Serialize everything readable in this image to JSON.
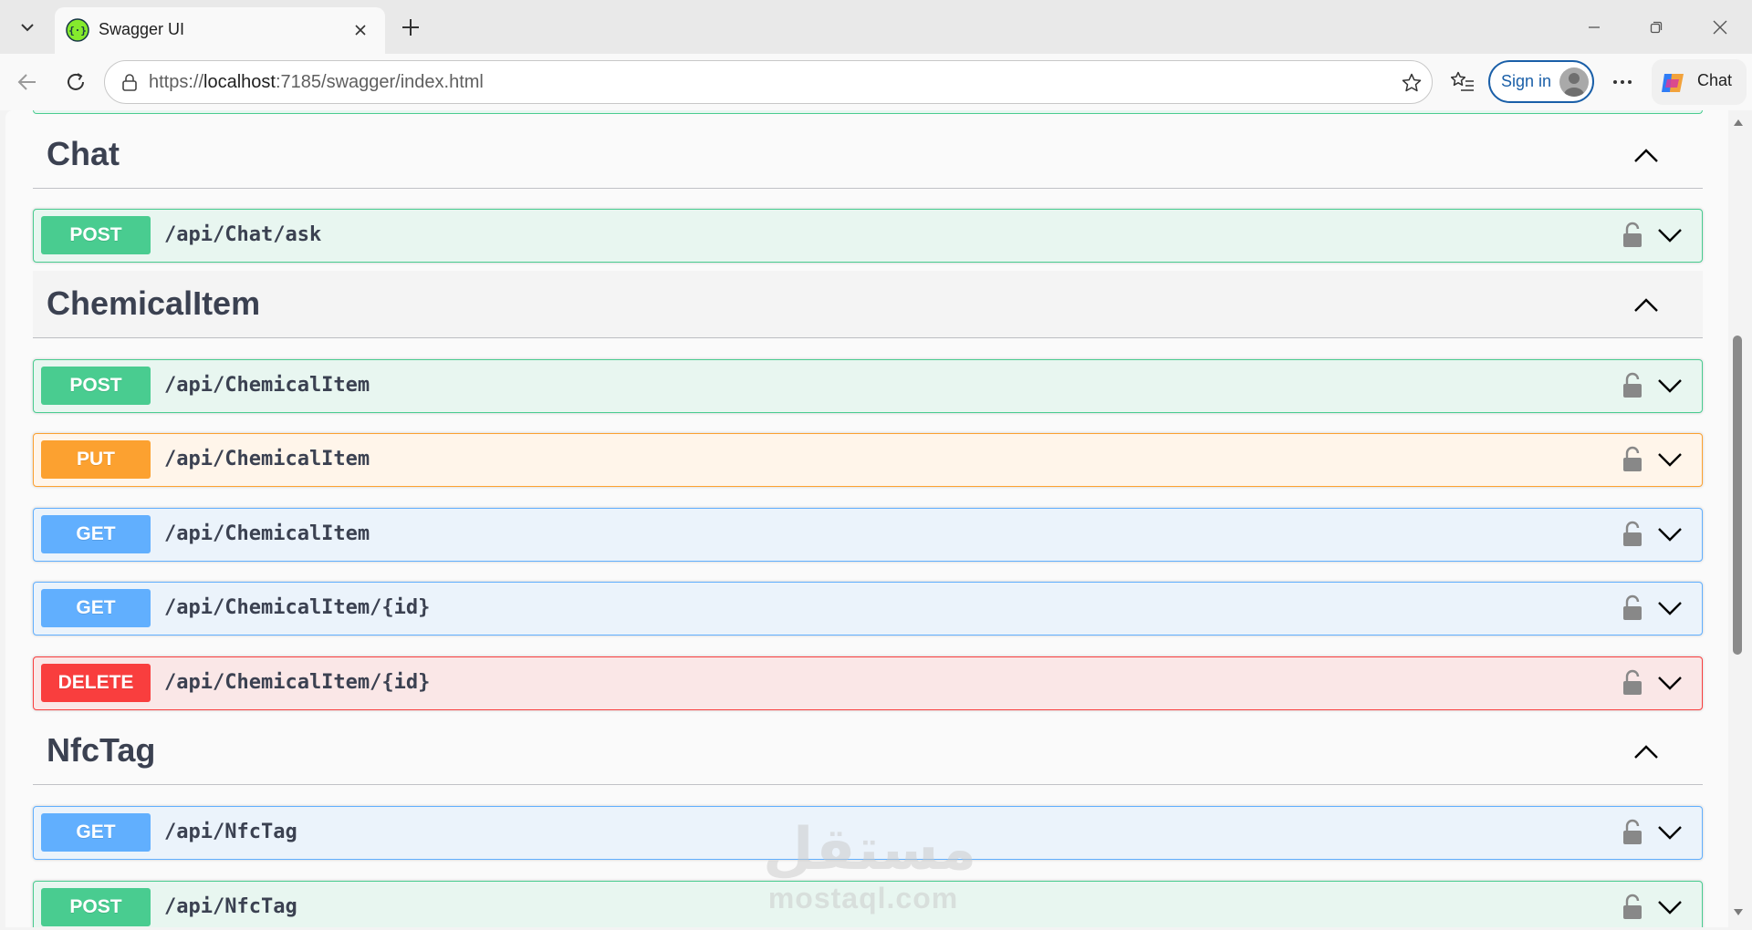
{
  "browser": {
    "tab": {
      "title": "Swagger UI"
    },
    "address": {
      "scheme": "https://",
      "host": "localhost",
      "rest": ":7185/swagger/index.html"
    },
    "signin_label": "Sign in",
    "copilot_label": "Chat"
  },
  "sections": [
    {
      "title": "Chat",
      "operations": [
        {
          "method": "POST",
          "path": "/api/Chat/ask"
        }
      ]
    },
    {
      "title": "ChemicalItem",
      "operations": [
        {
          "method": "POST",
          "path": "/api/ChemicalItem"
        },
        {
          "method": "PUT",
          "path": "/api/ChemicalItem"
        },
        {
          "method": "GET",
          "path": "/api/ChemicalItem"
        },
        {
          "method": "GET",
          "path": "/api/ChemicalItem/{id}"
        },
        {
          "method": "DELETE",
          "path": "/api/ChemicalItem/{id}"
        }
      ]
    },
    {
      "title": "NfcTag",
      "operations": [
        {
          "method": "GET",
          "path": "/api/NfcTag"
        },
        {
          "method": "POST",
          "path": "/api/NfcTag"
        }
      ]
    }
  ],
  "watermark": {
    "arabic": "مستقل",
    "latin": "mostaql.com"
  },
  "colors": {
    "post": "#49cc90",
    "put": "#fca130",
    "get": "#61affe",
    "delete": "#f93e3e",
    "text": "#3b4151",
    "signin_blue": "#1a5fa8"
  }
}
